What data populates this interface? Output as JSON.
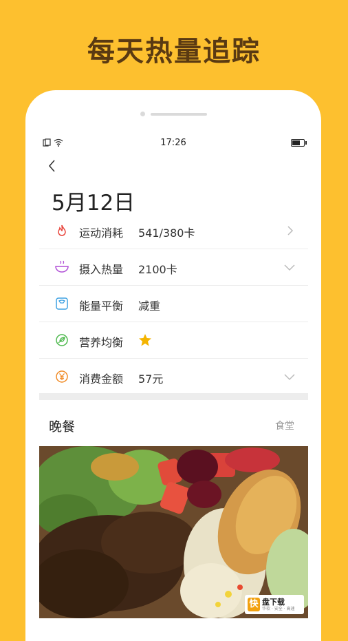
{
  "banner": {
    "headline": "每天热量追踪"
  },
  "status": {
    "time": "17:26",
    "battery_level": 0.7
  },
  "day": {
    "date": "5月12日"
  },
  "summary_rows": [
    {
      "icon": "flame-icon",
      "label": "运动消耗",
      "value": "541/380卡",
      "chevron": "right"
    },
    {
      "icon": "bowl-icon",
      "label": "摄入热量",
      "value": "2100卡",
      "chevron": "down"
    },
    {
      "icon": "scale-icon",
      "label": "能量平衡",
      "value": "减重",
      "chevron": "none"
    },
    {
      "icon": "leaf-icon",
      "label": "营养均衡",
      "value": "",
      "chevron": "none"
    },
    {
      "icon": "yen-icon",
      "label": "消费金额",
      "value": "57元",
      "chevron": "down"
    }
  ],
  "meal": {
    "title": "晚餐",
    "place": "食堂"
  },
  "watermark": {
    "logo": "快",
    "name": "盘下载",
    "tagline": "华软 · 安全 · 高速"
  },
  "colors": {
    "background": "#FDC02F",
    "headline": "#5A3A12",
    "accent_star": "#F4B400"
  }
}
